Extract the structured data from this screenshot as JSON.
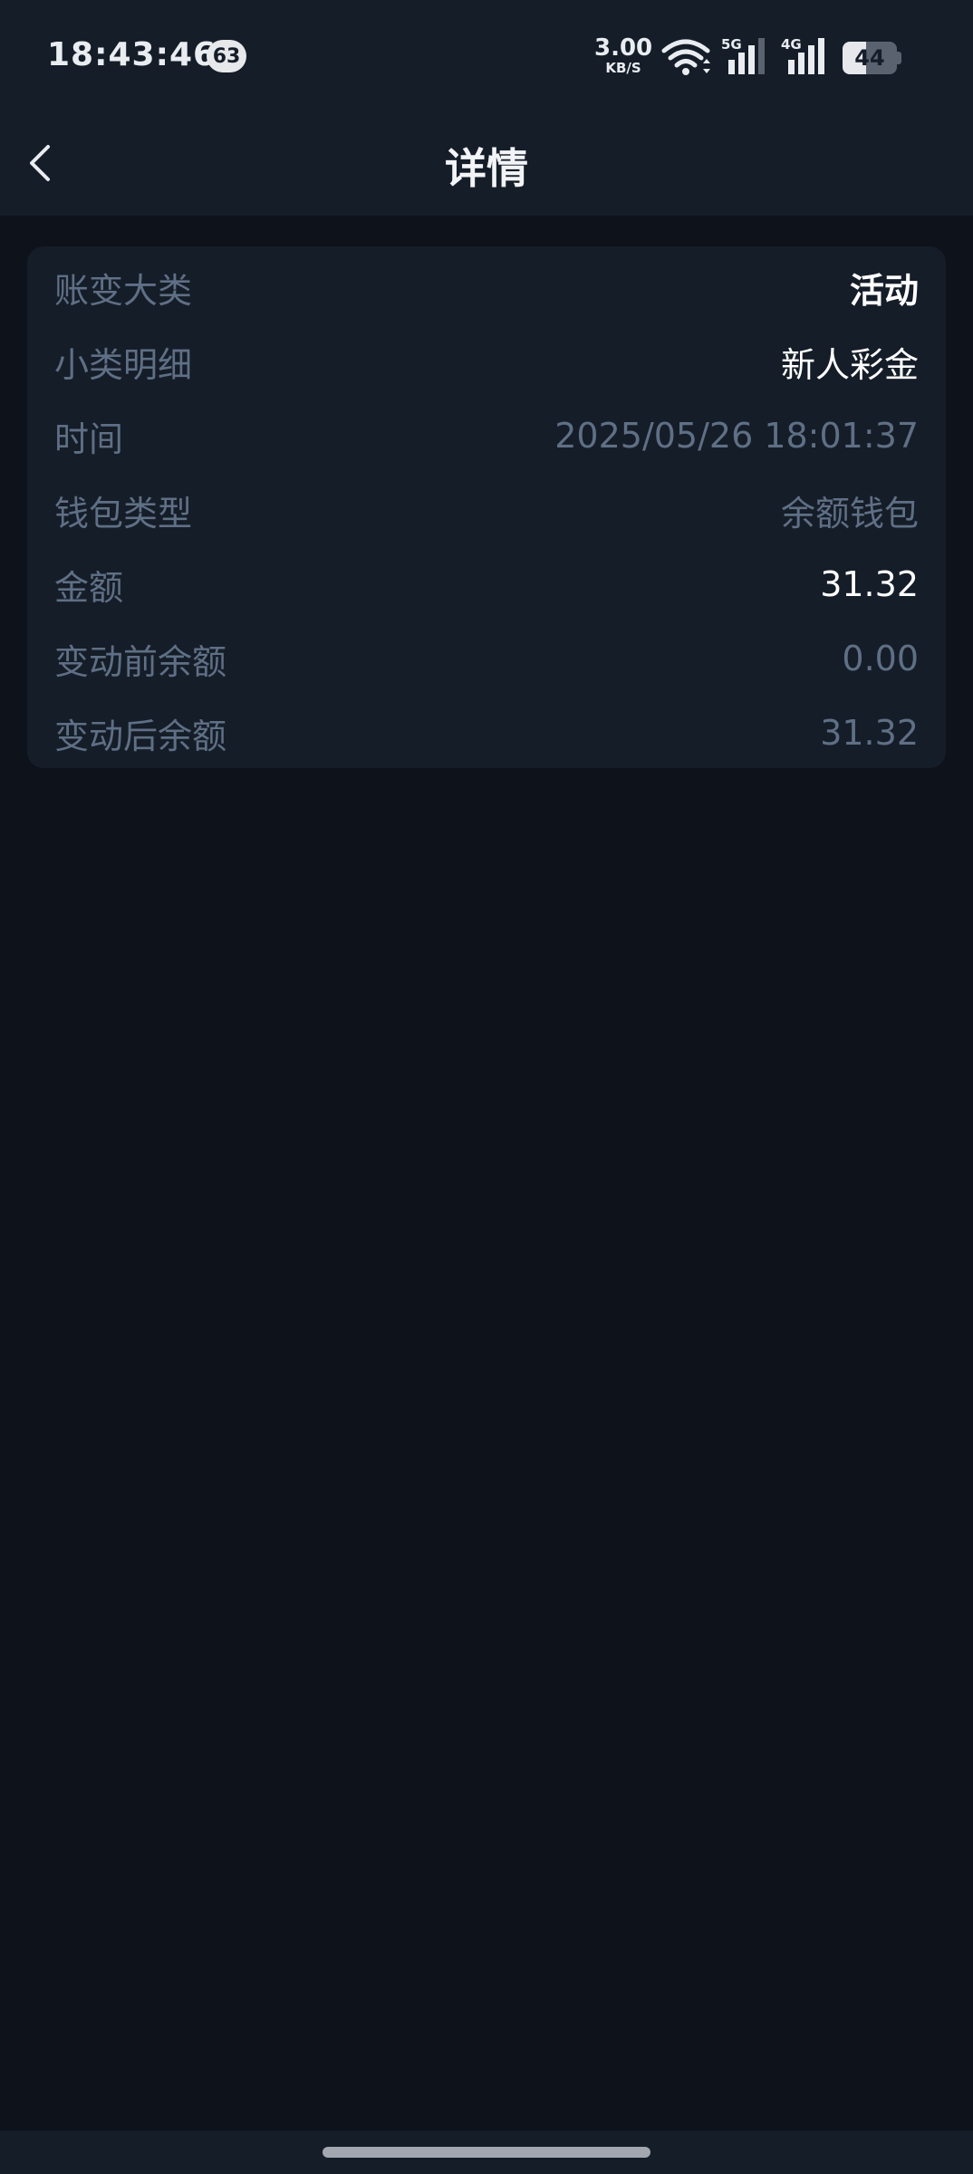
{
  "status_bar": {
    "time": "18:43:46",
    "notification_count": "63",
    "net_speed_value": "3.00",
    "net_speed_unit": "KB/S",
    "signal_1_type": "5G",
    "signal_2_type": "4G",
    "battery_level": "44",
    "battery_fraction": 0.44
  },
  "header": {
    "title": "详情",
    "back_icon": "chevron-left-icon"
  },
  "details": [
    {
      "label": "账变大类",
      "value": "活动",
      "style": "bright bold"
    },
    {
      "label": "小类明细",
      "value": "新人彩金",
      "style": "bright"
    },
    {
      "label": "时间",
      "value": "2025/05/26 18:01:37",
      "style": "muted"
    },
    {
      "label": "钱包类型",
      "value": "余额钱包",
      "style": "muted"
    },
    {
      "label": "金额",
      "value": "31.32",
      "style": "bright"
    },
    {
      "label": "变动前余额",
      "value": "0.00",
      "style": "muted"
    },
    {
      "label": "变动后余额",
      "value": "31.32",
      "style": "muted"
    }
  ],
  "colors": {
    "background": "#0e121a",
    "card": "#151d28",
    "label": "#5f6f85",
    "value_bright": "#ffffff"
  }
}
